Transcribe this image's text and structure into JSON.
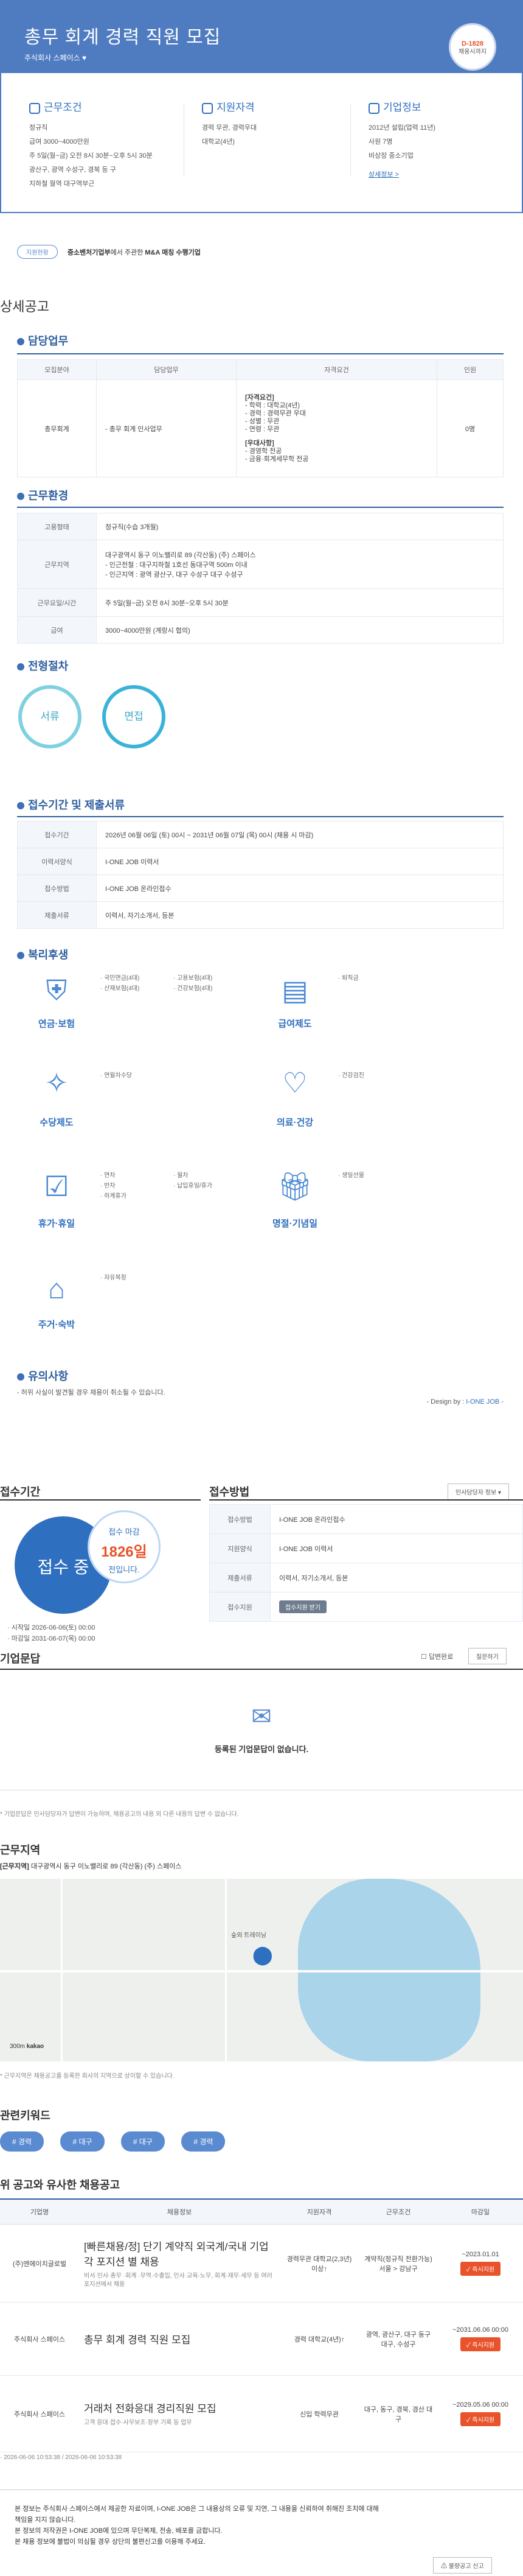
{
  "header": {
    "title": "총무 회계 경력 직원 모집",
    "company": "주식회사 스페이스",
    "dday": "D-1828",
    "dday_sub": "채용시까지"
  },
  "summary": {
    "conditions": {
      "title": "근무조건",
      "lines": [
        "정규직",
        "급여 3000~4000만원",
        "주 5일(월~금) 오전 8시 30분~오후 5시 30분",
        "광산구, 광역 수성구, 경북 등 구",
        "지하철 월역 대구역부근"
      ]
    },
    "qualify": {
      "title": "지원자격",
      "lines": [
        "경력 무관, 경력우대",
        "대학교(4년)"
      ]
    },
    "company": {
      "title": "기업정보",
      "lines": [
        "2012년 설립(업력 11년)",
        "사원 7명",
        "비상장 중소기업"
      ],
      "link": "상세정보 >"
    }
  },
  "tagline": {
    "pill": "지원현황",
    "text_pre": "중소벤처기업부",
    "text_mid": "에서 주관한 ",
    "text_bold": "M&A 매칭 수행기업"
  },
  "detail": {
    "title": "상세공고",
    "duty": {
      "title": "담당업무",
      "headers": [
        "모집분야",
        "담당업무",
        "자격요건",
        "인원"
      ],
      "row": {
        "field": "총무회계",
        "task": "- 총무 회계 인사업무",
        "req": [
          "[자격요건]",
          "- 학력 : 대학교(4년)",
          "- 경력 : 경력무관 우대",
          "- 성별 : 무관",
          "- 연령 : 무관",
          "",
          "[우대사항]",
          "- 경영학 전공",
          "- 금융·회계세무학 전공"
        ],
        "count": "0명"
      }
    },
    "env": {
      "title": "근무환경",
      "rows": [
        {
          "k": "고용형태",
          "v": [
            "정규직(수습 3개월)"
          ]
        },
        {
          "k": "근무지역",
          "v": [
            "대구광역시 동구 이노밸리로 89 (각산동) (주) 스페이스",
            "- 인근전철 : 대구지하철 1호선 동대구역 500m 이내",
            "- 인근지역 : 광역 광산구, 대구 수성구 대구 수성구"
          ]
        },
        {
          "k": "근무요일/시간",
          "v": [
            "주 5일(월~금) 오전 8시 30분~오후 5시 30분"
          ]
        },
        {
          "k": "급여",
          "v": [
            "3000~4000만원 (계랑시 협의)"
          ]
        }
      ]
    },
    "process": {
      "title": "전형절차",
      "steps": [
        "서류",
        "면접"
      ]
    },
    "submit": {
      "title": "접수기간 및 제출서류",
      "rows": [
        {
          "k": "접수기간",
          "v": "2026년 06월 06일 (토) 00시 ~ 2031년 06월 07일 (목) 00시 (채용 시 마감)"
        },
        {
          "k": "이력서양식",
          "v": "I-ONE JOB 이력서"
        },
        {
          "k": "접수방법",
          "v": "I-ONE JOB 온라인접수"
        },
        {
          "k": "제출서류",
          "v": "이력서, 자기소개서, 등본"
        }
      ]
    },
    "welfare": {
      "title": "복리후생",
      "items": [
        {
          "name": "연금·보험",
          "icon": "guard-icon",
          "left": [
            "· 국민연금(4대)",
            "· 산재보험(4대)"
          ],
          "right": [
            "· 고용보험(4대)",
            "· 건강보험(4대)"
          ]
        },
        {
          "name": "급여제도",
          "icon": "money-icon",
          "left": [
            "· 퇴직금"
          ],
          "right": []
        },
        {
          "name": "수당제도",
          "icon": "gamepad-icon",
          "left": [
            "· 연월차수당"
          ],
          "right": []
        },
        {
          "name": "의료·건강",
          "icon": "heart-icon",
          "left": [
            "· 건강검진"
          ],
          "right": []
        },
        {
          "name": "휴가·휴일",
          "icon": "calendar-icon",
          "left": [
            "· 연차",
            "· 반차",
            "· 하계휴가"
          ],
          "right": [
            "· 월차",
            "· 납입휴일/휴가"
          ]
        },
        {
          "name": "명절·기념일",
          "icon": "gift-icon",
          "left": [
            "· 생일선물"
          ],
          "right": []
        },
        {
          "name": "주거·숙박",
          "icon": "house-icon",
          "left": [
            "· 자유복장"
          ],
          "right": []
        }
      ]
    },
    "notice": {
      "title": "유의사항",
      "text": "- 허위 사실이 발견될 경우 채용이 취소될 수 있습니다.",
      "design_pre": "- Design by : ",
      "design": "I-ONE JOB -"
    }
  },
  "apply": {
    "period_title": "접수기간",
    "status": "접수 중",
    "remain_label": "접수 마감",
    "remain_days": "1826일",
    "remain_suffix": "전입니다.",
    "start": "· 시작일 2026-06-06(토) 00:00",
    "end": "· 마감일 2031-06-07(목) 00:00",
    "method_title": "접수방법",
    "print_btn": "인사담당자 정보 ▾",
    "rows": [
      {
        "k": "접수방법",
        "v": "I-ONE JOB 온라인접수"
      },
      {
        "k": "지원양식",
        "v": "I-ONE JOB 이력서"
      },
      {
        "k": "제출서류",
        "v": "이력서, 자기소개서, 등본"
      },
      {
        "k": "접수지원",
        "v": "접수지원 받기"
      }
    ]
  },
  "qa": {
    "title": "기업문답",
    "filter1": "답변완료",
    "filter2": "질문하기",
    "empty": "등록된 기업문답이 없습니다.",
    "note": "* 기업문답은 인사담당자가 답변이 가능하며, 채용공고의 내용 외 다른 내용의 답변 수 없습니다."
  },
  "location": {
    "title": "근무지역",
    "address_label": "[근무지역]",
    "address": " 대구광역시 동구 이노밸리로 89 (각산동) (주) 스페이스",
    "pin": "숲외 트레이닝",
    "note": "* 근무지역은 채용공고를 등록한 회사의 지역으로 상이할 수 있습니다.",
    "scale": "300m",
    "brand": "kakao"
  },
  "keywords": {
    "title": "관련키워드",
    "items": [
      "# 경력",
      "# 대구",
      "# 대구",
      "# 경력"
    ]
  },
  "similar": {
    "title": "위 공고와 유사한 채용공고",
    "headers": [
      "기업명",
      "채용정보",
      "지원자격",
      "근무조건",
      "마감일"
    ],
    "rows": [
      {
        "company": "(주)엔에이치글로벌",
        "title": "[빠른채용/정] 단기 계약직 외국계/국내 기업 각 포지션 별 채용",
        "sub": "비서·인사·총무 ·회계 ·무역·수출입, 인사·교육·노무, 회계·재무·세무 등 여러 포지션에서 채용",
        "qual": "경력무관 대학교(2,3년) 이상↑",
        "cond": "계약직(정규직 전환가능) 서울 > 강남구",
        "date": "~2023.01.01",
        "btn": "✓ 즉시지원"
      },
      {
        "company": "주식회사 스페이스",
        "title": "총무 회계 경력 직원 모집",
        "sub": "",
        "qual": "경력 대학교(4년)↑",
        "cond": "광역, 광산구, 대구 동구 대구, 수성구",
        "date": "~2031.06.06 00:00",
        "btn": "✓ 즉시지원"
      },
      {
        "company": "주식회사 스페이스",
        "title": "거래처 전화응대 경리직원 모집",
        "sub": "고객 응대·접수·사무보조·장부 기록 등 업무",
        "qual": "신입 학력무관",
        "cond": "대구, 동구, 경북, 경산 대구",
        "date": "~2029.05.06 00:00",
        "btn": "✓ 즉시지원"
      }
    ],
    "stamp": "· 2026-06-06 10:53:38 / 2026-06-06 10:53:38"
  },
  "footer": {
    "lines": [
      "본 정보는 주식회사 스페이스에서 제공한 자료이며, I-ONE JOB은 그 내용상의 오류 및 지연, 그 내용을 신뢰하여 취해진 조치에 대해 책임을 지지 않습니다.",
      "본 정보의 저작권은 I-ONE JOB에 있으며 무단복제, 전송, 배포를 금합니다.",
      "본 채용 정보에 불법이 의심될 경우 상단의 불편신고를 이용해 주세요."
    ],
    "report_btn": "불량공고 신고"
  },
  "colors": {
    "brand": "#4f7cc1",
    "accent": "#e8532b",
    "teal": "#3aa7c6"
  }
}
